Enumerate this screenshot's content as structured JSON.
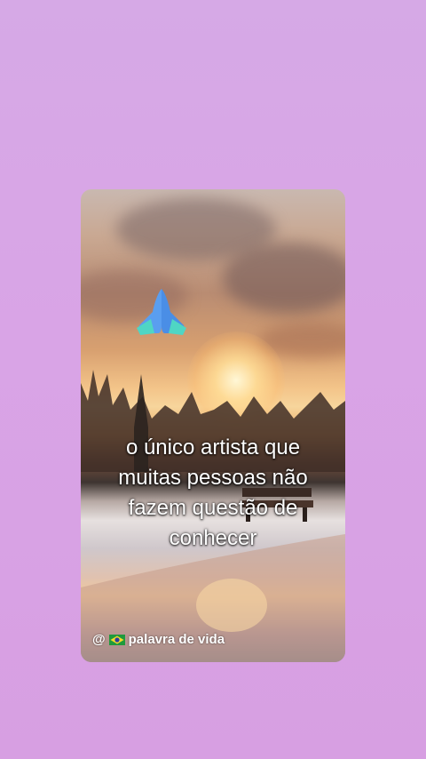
{
  "overlay": {
    "emoji_icon": "praying-hands-icon",
    "caption_lines": [
      "o único artista que",
      "muitas pessoas não",
      "fazem questão de",
      "conhecer"
    ]
  },
  "watermark": {
    "at_symbol": "@",
    "flag_icon": "brazil-flag-icon",
    "handle": "palavra de vida"
  },
  "colors": {
    "background": "#d8a5e5",
    "caption_text": "#ffffff"
  }
}
